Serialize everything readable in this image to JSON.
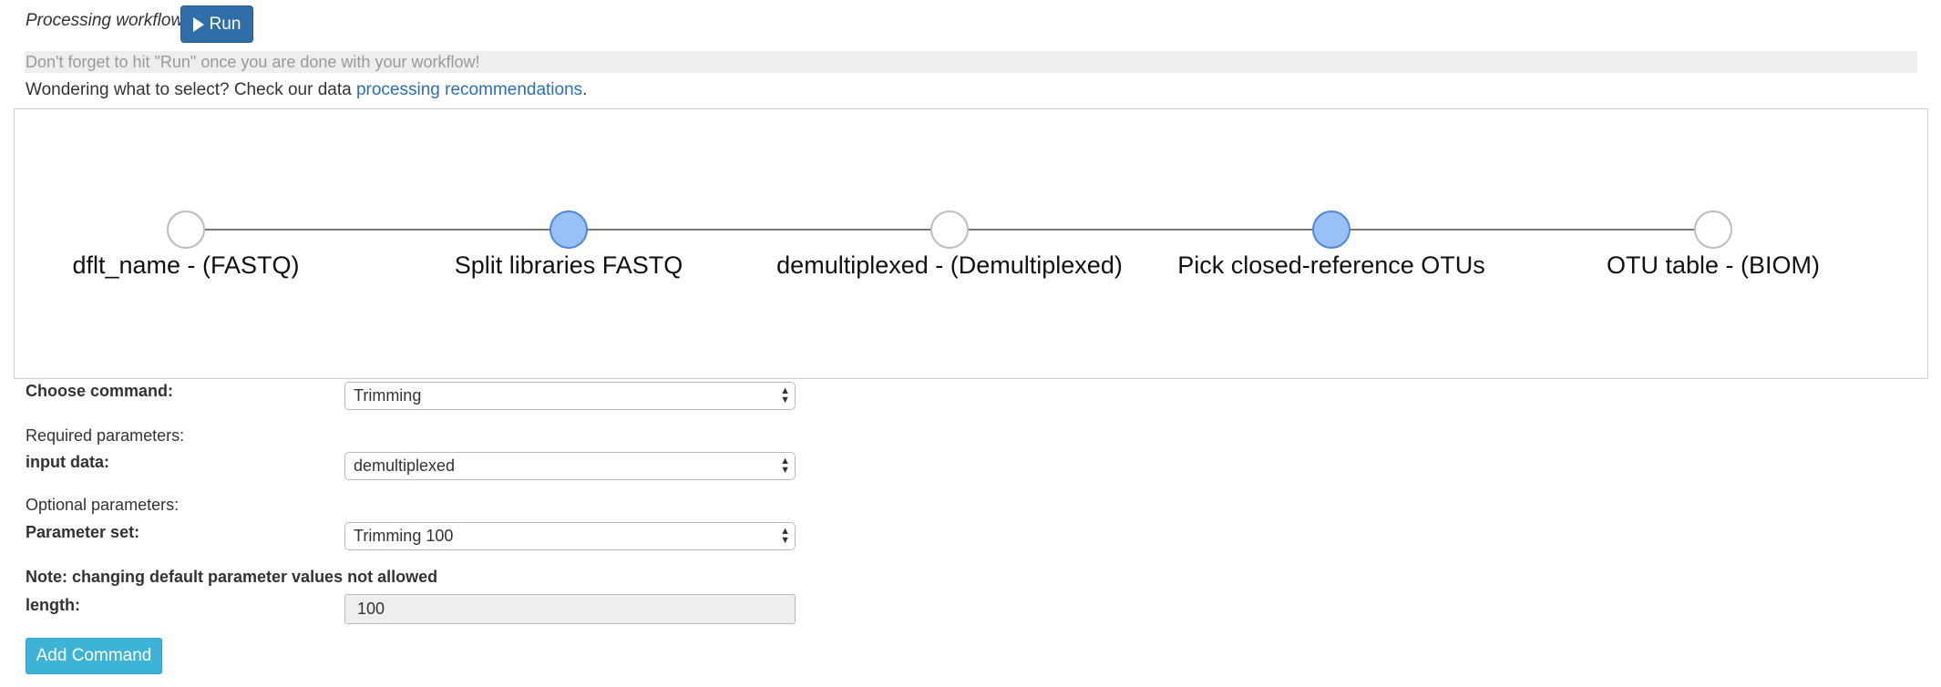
{
  "header": {
    "title": "Processing workflow",
    "run_label": "Run"
  },
  "notice": "Don't forget to hit \"Run\" once you are done with your workflow!",
  "help": {
    "prefix": "Wondering what to select? Check our data ",
    "link_text": "processing recommendations",
    "suffix": "."
  },
  "workflow": {
    "nodes": [
      {
        "label": "dflt_name - (FASTQ)",
        "type": "artifact",
        "active": false
      },
      {
        "label": "Split libraries FASTQ",
        "type": "process",
        "active": true
      },
      {
        "label": "demultiplexed - (Demultiplexed)",
        "type": "artifact",
        "active": false
      },
      {
        "label": "Pick closed-reference OTUs",
        "type": "process",
        "active": true
      },
      {
        "label": "OTU table - (BIOM)",
        "type": "artifact",
        "active": false
      }
    ],
    "colors": {
      "active_fill": "#9ac0f8",
      "active_border": "#4c88e0",
      "inactive_border": "#bdbdbd"
    }
  },
  "form": {
    "choose_command_label": "Choose command:",
    "command_value": "Trimming",
    "required_label": "Required parameters:",
    "input_data_label": "input data:",
    "input_data_value": "demultiplexed",
    "optional_label": "Optional parameters:",
    "parameter_set_label": "Parameter set:",
    "parameter_set_value": "Trimming 100",
    "note": "Note: changing default parameter values not allowed",
    "length_label": "length:",
    "length_value": "100",
    "add_command_label": "Add Command"
  },
  "icons": {
    "run": "play-icon",
    "select": "up-down-arrows-icon"
  },
  "colors": {
    "run_button": "#2f6ea8",
    "link": "#2a6fbb",
    "add_button": "#3cb3d7"
  }
}
